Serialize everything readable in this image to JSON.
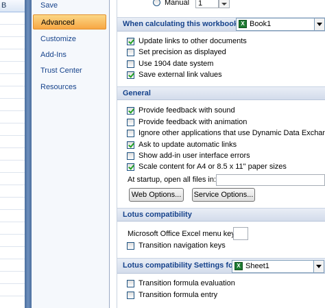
{
  "sheet": {
    "column_header": "B"
  },
  "nav": {
    "items": [
      {
        "label": "Save"
      },
      {
        "label": "Advanced"
      },
      {
        "label": "Customize"
      },
      {
        "label": "Add-Ins"
      },
      {
        "label": "Trust Center"
      },
      {
        "label": "Resources"
      }
    ],
    "selected": "Advanced"
  },
  "top_row": {
    "manual_label": "Manual",
    "spinner_value": "1"
  },
  "workbook_section": {
    "title": "When calculating this workbook:",
    "workbook_value": "Book1",
    "options": [
      {
        "label": "Update links to other documents",
        "checked": true
      },
      {
        "label": "Set precision as displayed",
        "checked": false
      },
      {
        "label": "Use 1904 date system",
        "checked": false
      },
      {
        "label": "Save external link values",
        "checked": true
      }
    ]
  },
  "general_section": {
    "title": "General",
    "options": [
      {
        "label": "Provide feedback with sound",
        "checked": true
      },
      {
        "label": "Provide feedback with animation",
        "checked": false
      },
      {
        "label": "Ignore other applications that use Dynamic Data Exchange (D",
        "checked": false
      },
      {
        "label": "Ask to update automatic links",
        "checked": true
      },
      {
        "label": "Show add-in user interface errors",
        "checked": false
      },
      {
        "label": "Scale content for A4 or 8.5 x 11\" paper sizes",
        "checked": true
      }
    ],
    "startup_label": "At startup, open all files in:",
    "startup_value": "",
    "web_options_label": "Web Options...",
    "service_options_label": "Service Options..."
  },
  "lotus_section": {
    "title": "Lotus compatibility",
    "menu_key_label": "Microsoft Office Excel menu key:",
    "menu_key_value": "",
    "options": [
      {
        "label": "Transition navigation keys",
        "checked": false
      }
    ]
  },
  "lotus_settings_section": {
    "title": "Lotus compatibility Settings for:",
    "sheet_value": "Sheet1",
    "options": [
      {
        "label": "Transition formula evaluation",
        "checked": false
      },
      {
        "label": "Transition formula entry",
        "checked": false
      }
    ]
  }
}
